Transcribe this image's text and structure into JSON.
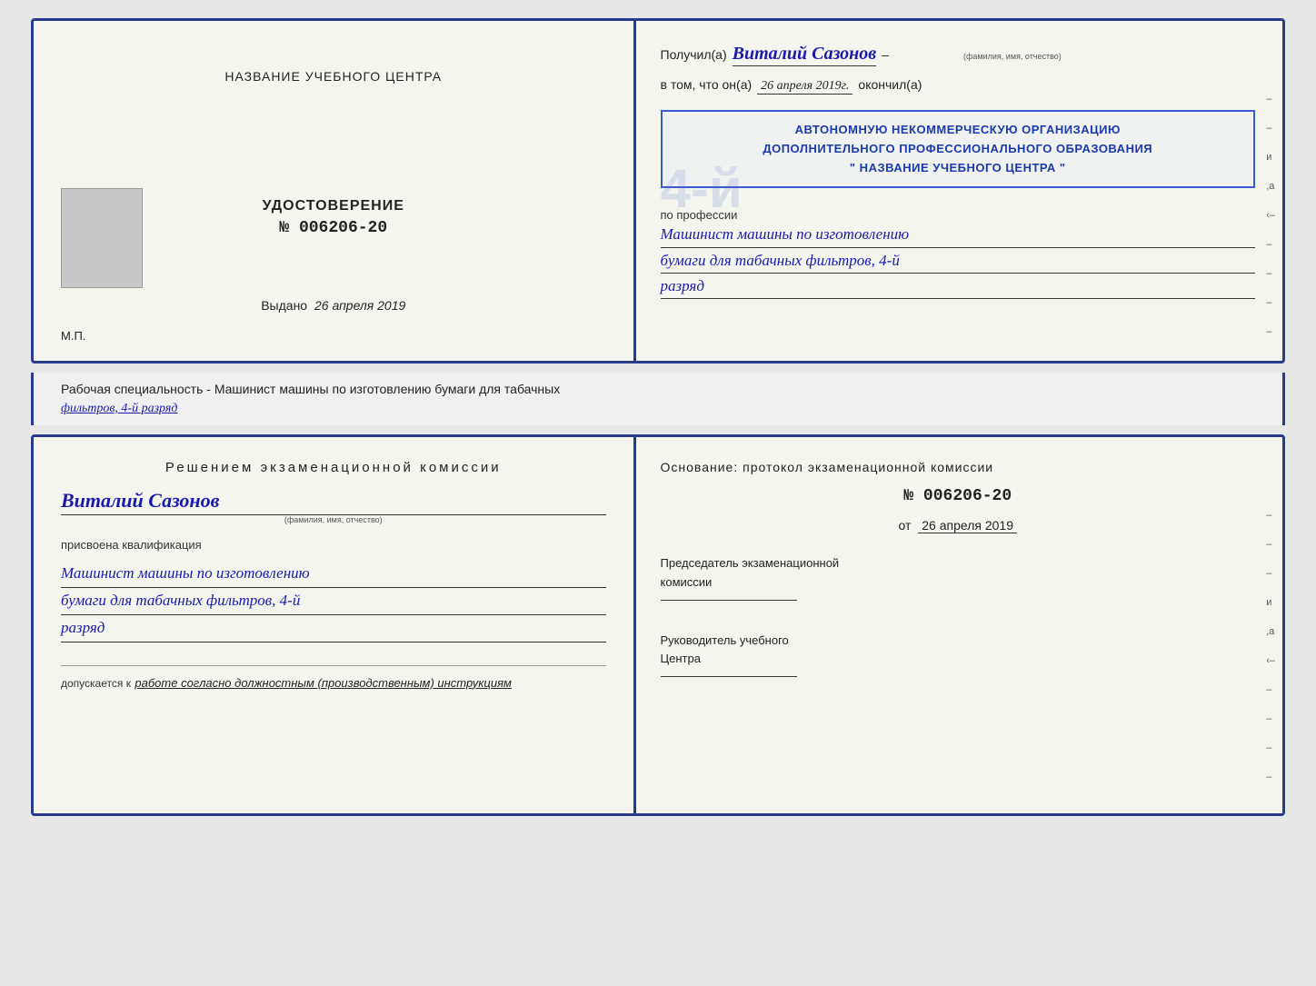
{
  "page": {
    "background": "#e8e8e8"
  },
  "top_cert": {
    "left": {
      "institution_title": "НАЗВАНИЕ УЧЕБНОГО ЦЕНТРА",
      "udostoverenie_label": "УДОСТОВЕРЕНИЕ",
      "cert_number": "№ 006206-20",
      "vydano_label": "Выдано",
      "vydano_date": "26 апреля 2019",
      "mp_label": "М.П."
    },
    "right": {
      "poluchil_prefix": "Получил(а)",
      "recipient_name": "Виталий Сазонов",
      "fio_subtitle": "(фамилия, имя, отчество)",
      "dash": "–",
      "vtom_prefix": "в том, что он(а)",
      "date_handwritten": "26 апреля 2019г.",
      "okonchil": "окончил(а)",
      "stamp_line1": "АВТОНОМНУЮ НЕКОММЕРЧЕСКУЮ ОРГАНИЗАЦИЮ",
      "stamp_line2": "ДОПОЛНИТЕЛЬНОГО ПРОФЕССИОНАЛЬНОГО ОБРАЗОВАНИЯ",
      "stamp_line3": "\" НАЗВАНИЕ УЧЕБНОГО ЦЕНТРА \"",
      "profession_label": "по профессии",
      "profession_line1": "Машинист машины по изготовлению",
      "profession_line2": "бумаги для табачных фильтров, 4-й",
      "profession_line3": "разряд",
      "side_marks": [
        "–",
        "–",
        "и",
        ",а",
        "‹–",
        "–",
        "–",
        "–",
        "–"
      ]
    }
  },
  "middle_strip": {
    "text_prefix": "Рабочая специальность - Машинист машины по изготовлению бумаги для табачных",
    "text_underline": "фильтров, 4-й разряд"
  },
  "bottom_cert": {
    "left": {
      "reshenie_title": "Решением  экзаменационной  комиссии",
      "name_handwritten": "Виталий Сазонов",
      "fio_subtitle": "(фамилия, имя, отчество)",
      "prisvoena_text": "присвоена квалификация",
      "kvalif_line1": "Машинист машины по изготовлению",
      "kvalif_line2": "бумаги для табачных фильтров, 4-й",
      "kvalif_line3": "разряд",
      "dopuskaetsya_prefix": "допускается к",
      "dopuskaetsya_italic": "работе согласно должностным (производственным) инструкциям"
    },
    "right": {
      "osnovanie_title": "Основание:  протокол  экзаменационной  комиссии",
      "protocol_number": "№  006206-20",
      "ot_prefix": "от",
      "ot_date": "26 апреля 2019",
      "predsedatel_title": "Председатель экзаменационной",
      "komissii_label": "комиссии",
      "rukovoditel_title": "Руководитель учебного",
      "tsentra_label": "Центра",
      "side_marks": [
        "–",
        "–",
        "–",
        "и",
        ",а",
        "‹–",
        "–",
        "–",
        "–",
        "–"
      ]
    }
  }
}
